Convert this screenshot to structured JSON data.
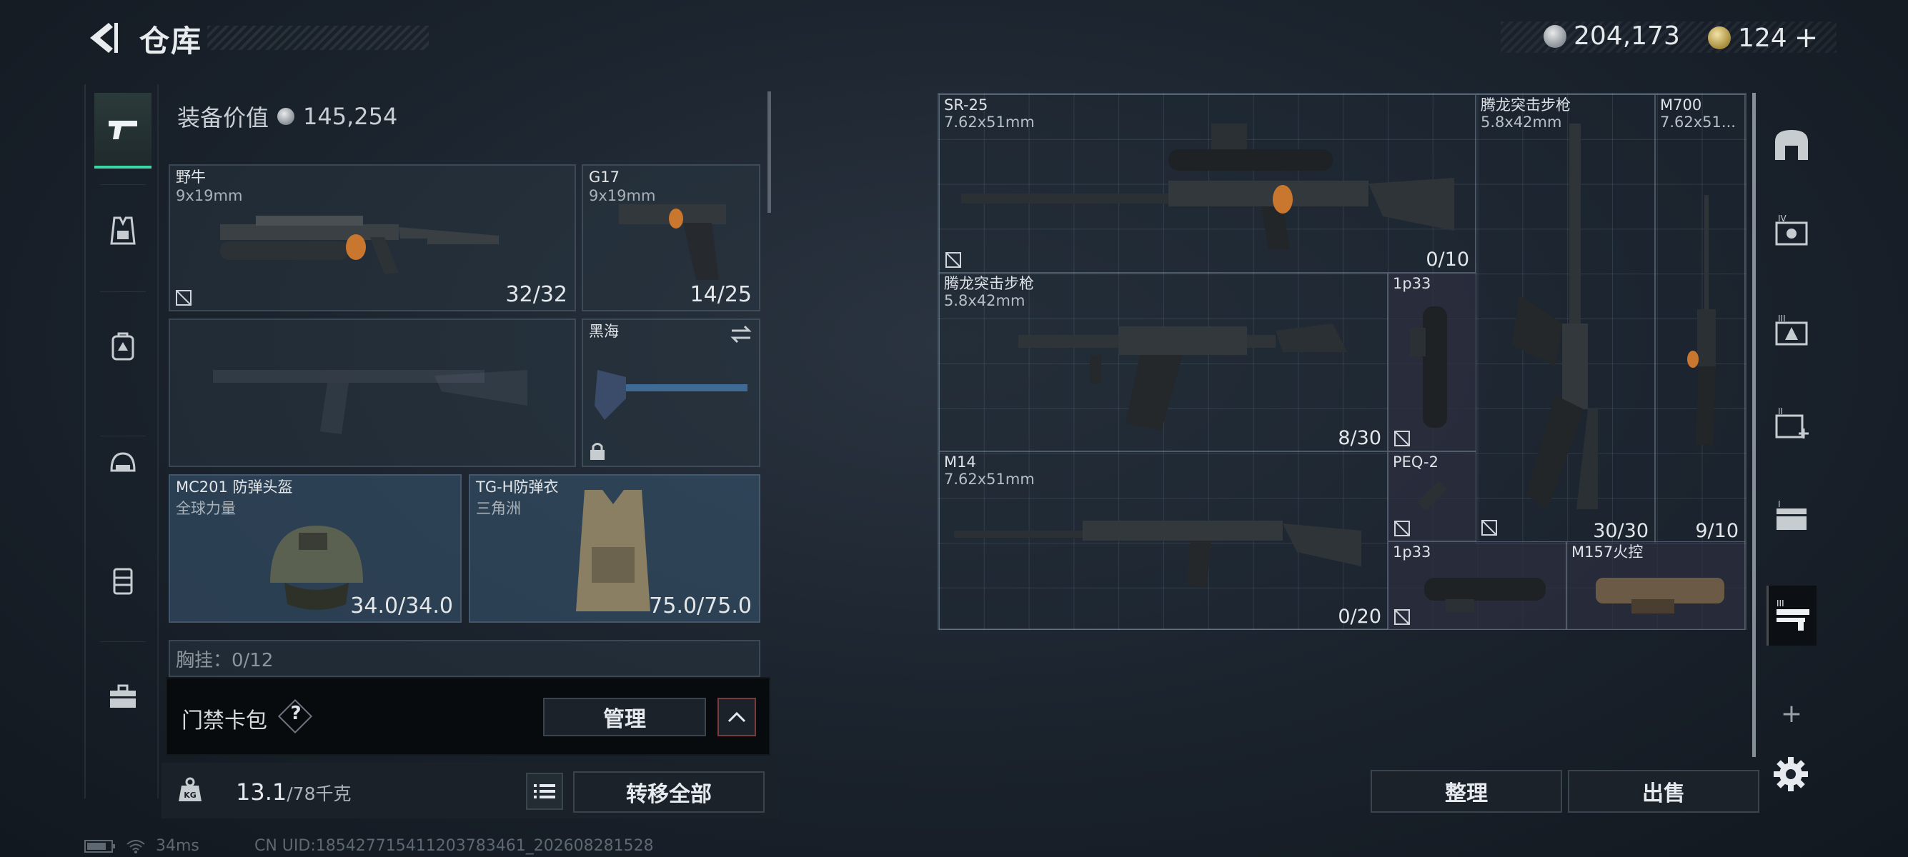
{
  "header": {
    "title": "仓库",
    "currency_silver": "204,173",
    "currency_gold": "124",
    "currency_gold_add": "+"
  },
  "equipment": {
    "value_label": "装备价值",
    "value": "145,254",
    "slots": [
      {
        "name": "野牛",
        "sub": "9x19mm",
        "count": "32/32"
      },
      {
        "name": "G17",
        "sub": "9x19mm",
        "count": "14/25"
      },
      {
        "name": "黑海",
        "sub": "",
        "count": ""
      },
      {
        "name": "MC201 防弹头盔",
        "sub": "全球力量",
        "count": "34.0/34.0"
      },
      {
        "name": "TG-H防弹衣",
        "sub": "三角洲",
        "count": "75.0/75.0"
      }
    ],
    "chest_rig_partial": "胸挂：0/12"
  },
  "card_bag": {
    "label": "门禁卡包",
    "help": "?",
    "manage": "管理"
  },
  "weight": {
    "current": "13.1",
    "max": "/78千克"
  },
  "transfer_all": "转移全部",
  "status": {
    "ping": "34ms",
    "uid": "CN UID:1854277154112037834​61_202608281528"
  },
  "warehouse": {
    "items": [
      {
        "name": "SR-25",
        "sub": "7.62x51mm",
        "count": "0/10"
      },
      {
        "name": "腾龙突击步枪",
        "sub": "5.8x42mm",
        "count": "30/30"
      },
      {
        "name": "M700",
        "sub": "7.62x51...",
        "count": "9/10"
      },
      {
        "name": "腾龙突击步枪",
        "sub": "5.8x42mm",
        "count": "8/30"
      },
      {
        "name": "1p33",
        "sub": "",
        "count": ""
      },
      {
        "name": "M14",
        "sub": "7.62x51mm",
        "count": "0/20"
      },
      {
        "name": "PEQ-2",
        "sub": "",
        "count": ""
      },
      {
        "name": "1p33",
        "sub": "",
        "count": ""
      },
      {
        "name": "M157火控",
        "sub": "",
        "count": ""
      }
    ]
  },
  "actions": {
    "sort": "整理",
    "sell": "出售"
  },
  "rrail": {
    "add": "+"
  },
  "icons": [
    "back-arrow-icon",
    "pistol-icon",
    "vest-icon",
    "backpack-icon",
    "helmet-icon",
    "rig-icon",
    "toolbox-icon",
    "kg-icon",
    "list-icon",
    "chevron-up-icon",
    "gear-icon"
  ]
}
